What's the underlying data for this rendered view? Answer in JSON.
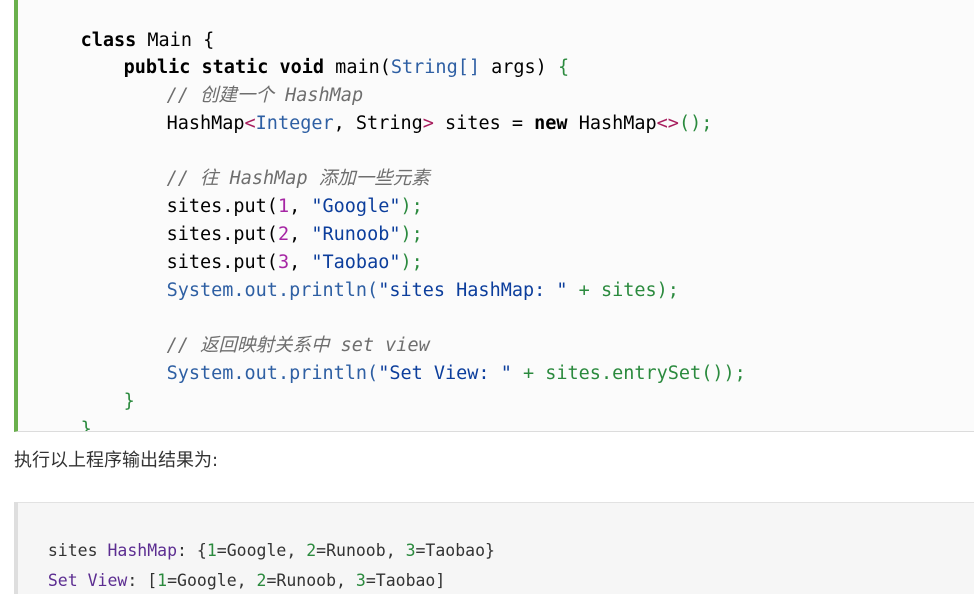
{
  "code": {
    "l1_kw": "class",
    "l1_name": " Main ",
    "l1_brace": "{",
    "l2_kw": "public static void",
    "l2_main": " main(",
    "l2_type": "String[]",
    "l2_args": " args) ",
    "l2_brace": "{",
    "l3_comment": "// 创建一个 HashMap",
    "l4_a": "HashMap",
    "l4_lt": "<",
    "l4_t1": "Integer",
    "l4_comma": ", ",
    "l4_t2": "String",
    "l4_gt": ">",
    "l4_b": " sites = ",
    "l4_new": "new",
    "l4_c": " HashMap",
    "l4_diamond": "<>",
    "l4_d": "();",
    "l6_comment": "// 往 HashMap 添加一些元素",
    "puts": [
      {
        "pre": "sites.put(",
        "num": "1",
        "mid": ", ",
        "str": "\"Google\"",
        "end": ");"
      },
      {
        "pre": "sites.put(",
        "num": "2",
        "mid": ", ",
        "str": "\"Runoob\"",
        "end": ");"
      },
      {
        "pre": "sites.put(",
        "num": "3",
        "mid": ", ",
        "str": "\"Taobao\"",
        "end": ");"
      }
    ],
    "l10_sys": "System.out.println(",
    "l10_str": "\"sites HashMap: \"",
    "l10_rest": " + sites);",
    "l12_comment": "// 返回映射关系中 set view",
    "l13_sys": "System.out.println(",
    "l13_str": "\"Set View: \"",
    "l13_rest": " + sites.entrySet());",
    "l14_brace": "}",
    "l15_brace": "}"
  },
  "caption": "执行以上程序输出结果为:",
  "output": {
    "line1_label": "sites",
    "line1_key": " HashMap",
    "line1_sep": ": ",
    "line1_open": "{",
    "line1_body": [
      {
        "n": "1",
        "v": "=Google"
      },
      {
        "n": "2",
        "v": "=Runoob"
      },
      {
        "n": "3",
        "v": "=Taobao"
      }
    ],
    "line1_close": "}",
    "line2_label": "Set",
    "line2_key": " View",
    "line2_sep": ": ",
    "line2_open": "[",
    "line2_close": "]",
    "comma": ", "
  }
}
